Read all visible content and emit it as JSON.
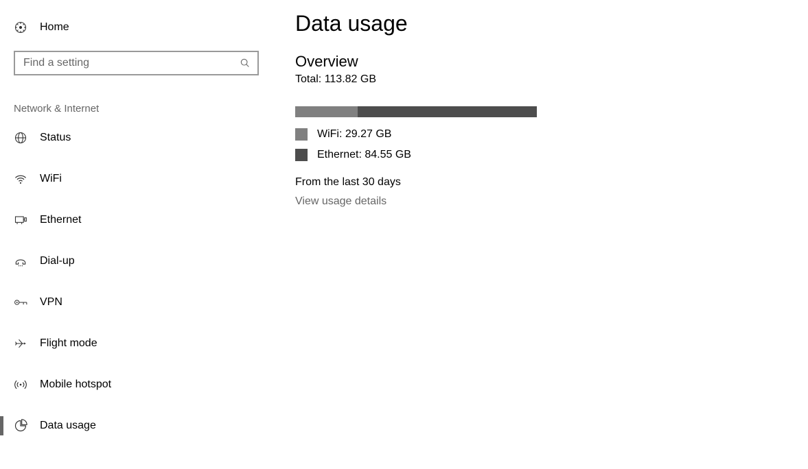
{
  "sidebar": {
    "home_label": "Home",
    "search_placeholder": "Find a setting",
    "section_header": "Network & Internet",
    "items": [
      {
        "key": "status",
        "label": "Status",
        "icon": "status-icon",
        "selected": false
      },
      {
        "key": "wifi",
        "label": "WiFi",
        "icon": "wifi-icon",
        "selected": false
      },
      {
        "key": "ethernet",
        "label": "Ethernet",
        "icon": "ethernet-icon",
        "selected": false
      },
      {
        "key": "dialup",
        "label": "Dial-up",
        "icon": "dialup-icon",
        "selected": false
      },
      {
        "key": "vpn",
        "label": "VPN",
        "icon": "vpn-icon",
        "selected": false
      },
      {
        "key": "flight-mode",
        "label": "Flight mode",
        "icon": "airplane-icon",
        "selected": false
      },
      {
        "key": "mobile-hotspot",
        "label": "Mobile hotspot",
        "icon": "hotspot-icon",
        "selected": false
      },
      {
        "key": "data-usage",
        "label": "Data usage",
        "icon": "data-usage-icon",
        "selected": true
      }
    ]
  },
  "main": {
    "page_title": "Data usage",
    "overview_title": "Overview",
    "total_label": "Total: 113.82 GB",
    "legend": {
      "wifi": {
        "label": "WiFi: 29.27 GB",
        "value_gb": 29.27
      },
      "ethernet": {
        "label": "Ethernet: 84.55 GB",
        "value_gb": 84.55
      }
    },
    "period_label": "From the last 30 days",
    "details_link": "View usage details"
  },
  "chart_data": {
    "type": "bar",
    "title": "Data usage overview",
    "series": [
      {
        "name": "WiFi",
        "value_gb": 29.27,
        "color": "#808080"
      },
      {
        "name": "Ethernet",
        "value_gb": 84.55,
        "color": "#4d4d4d"
      }
    ],
    "total_gb": 113.82
  }
}
